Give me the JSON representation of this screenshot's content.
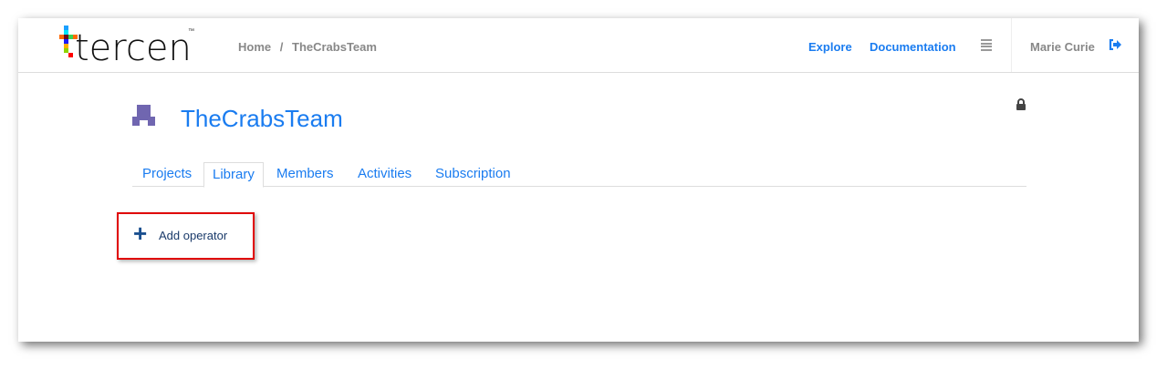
{
  "header": {
    "logo_text": "tercen",
    "logo_tm": "™",
    "breadcrumb": [
      "Home",
      "/",
      "TheCrabsTeam"
    ],
    "nav": {
      "explore": "Explore",
      "documentation": "Documentation"
    },
    "user_name": "Marie Curie",
    "icons": {
      "menu": "hamburger-icon",
      "logout": "sign-out-icon"
    }
  },
  "team": {
    "name": "TheCrabsTeam",
    "icon": "team-icon",
    "lock_icon": "lock-icon"
  },
  "tabs": [
    {
      "label": "Projects"
    },
    {
      "label": "Library",
      "active": true
    },
    {
      "label": "Members"
    },
    {
      "label": "Activities"
    },
    {
      "label": "Subscription"
    }
  ],
  "library": {
    "add_operator_label": "Add operator",
    "add_icon": "plus-icon"
  },
  "colors": {
    "accent": "#1a7cf0",
    "highlight": "#e00000",
    "team_icon": "#7066b0"
  }
}
